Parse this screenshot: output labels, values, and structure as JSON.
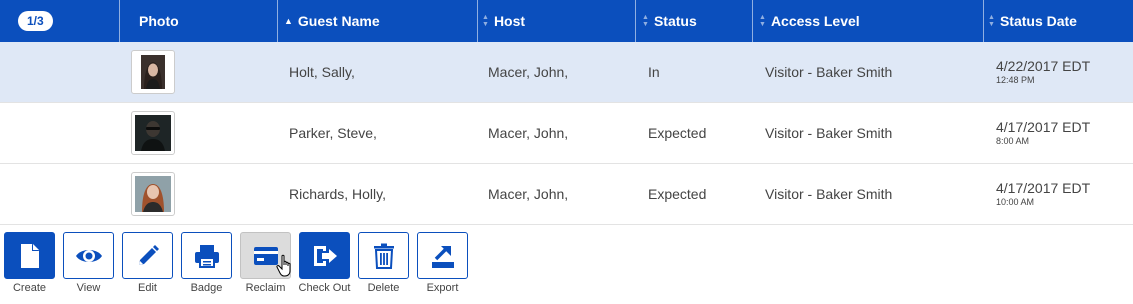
{
  "header": {
    "count_badge": "1/3",
    "columns": [
      "Photo",
      "Guest Name",
      "Host",
      "Status",
      "Access Level",
      "Status Date"
    ]
  },
  "rows": [
    {
      "guest": "Holt, Sally,",
      "host": "Macer, John,",
      "status": "In",
      "access": "Visitor - Baker Smith",
      "date": "4/22/2017 EDT",
      "time": "12:48 PM",
      "selected": true
    },
    {
      "guest": "Parker, Steve,",
      "host": "Macer, John,",
      "status": "Expected",
      "access": "Visitor - Baker Smith",
      "date": "4/17/2017 EDT",
      "time": "8:00 AM",
      "selected": false
    },
    {
      "guest": "Richards, Holly,",
      "host": "Macer, John,",
      "status": "Expected",
      "access": "Visitor - Baker Smith",
      "date": "4/17/2017 EDT",
      "time": "10:00 AM",
      "selected": false
    }
  ],
  "toolbar": {
    "create": "Create",
    "view": "View",
    "edit": "Edit",
    "badge": "Badge",
    "reclaim": "Reclaim",
    "checkout": "Check Out",
    "delete": "Delete",
    "export": "Export"
  },
  "colors": {
    "primary": "#0b4fbd",
    "selected_row": "#dfe8f6"
  },
  "icons": [
    "document-icon",
    "eye-icon",
    "pencil-icon",
    "printer-icon",
    "card-icon",
    "checkout-icon",
    "trash-icon",
    "export-icon",
    "hand-cursor-icon"
  ]
}
